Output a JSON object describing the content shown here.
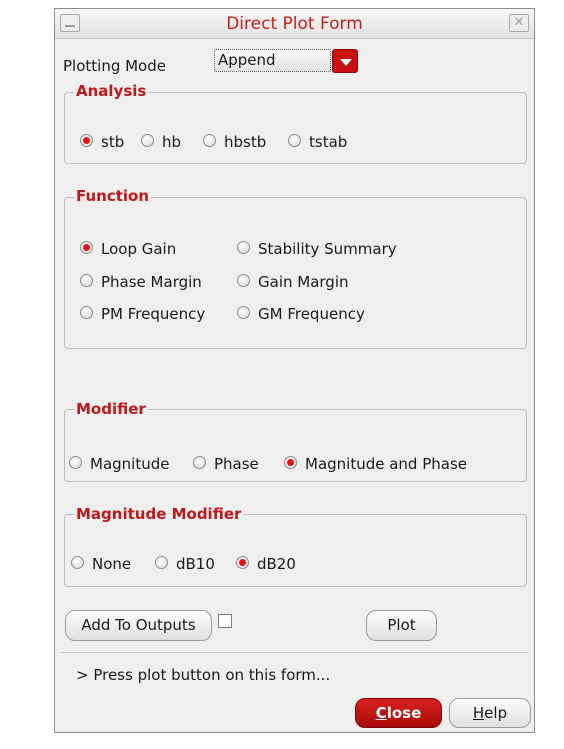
{
  "window": {
    "title": "Direct Plot Form"
  },
  "plotting_mode": {
    "label": "Plotting Mode",
    "value": "Append"
  },
  "analysis": {
    "label": "Analysis",
    "options": [
      {
        "label": "stb",
        "selected": true
      },
      {
        "label": "hb",
        "selected": false
      },
      {
        "label": "hbstb",
        "selected": false
      },
      {
        "label": "tstab",
        "selected": false
      }
    ]
  },
  "function": {
    "label": "Function",
    "options": [
      {
        "label": "Loop Gain",
        "selected": true
      },
      {
        "label": "Stability Summary",
        "selected": false
      },
      {
        "label": "Phase Margin",
        "selected": false
      },
      {
        "label": "Gain Margin",
        "selected": false
      },
      {
        "label": "PM Frequency",
        "selected": false
      },
      {
        "label": "GM Frequency",
        "selected": false
      }
    ]
  },
  "modifier": {
    "label": "Modifier",
    "options": [
      {
        "label": "Magnitude",
        "selected": false
      },
      {
        "label": "Phase",
        "selected": false
      },
      {
        "label": "Magnitude and Phase",
        "selected": true
      }
    ]
  },
  "magnitude_modifier": {
    "label": "Magnitude Modifier",
    "options": [
      {
        "label": "None",
        "selected": false
      },
      {
        "label": "dB10",
        "selected": false
      },
      {
        "label": "dB20",
        "selected": true
      }
    ]
  },
  "actions": {
    "add_to_outputs": "Add To Outputs",
    "add_to_outputs_checked": false,
    "plot": "Plot"
  },
  "status": "> Press plot button on this form...",
  "footer": {
    "close_mnemonic": "C",
    "close_rest": "lose",
    "help_mnemonic": "H",
    "help_rest": "elp"
  },
  "icons": {
    "minimize": "minimize-icon",
    "close": "window-close-icon",
    "dropdown": "dropdown-arrow-icon"
  },
  "colors": {
    "accent": "#c81010",
    "title_text": "#c81e1e",
    "group_label": "#c01818",
    "background": "#efefef"
  }
}
